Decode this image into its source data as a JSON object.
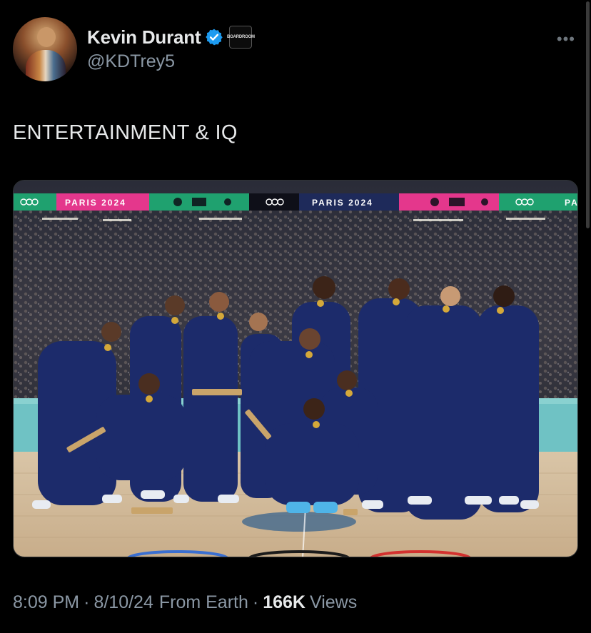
{
  "author": {
    "display_name": "Kevin Durant",
    "handle": "@KDTrey5",
    "verified": true,
    "affiliate_badge": "BOARDROOM"
  },
  "more_icon": "more-horizontal-icon",
  "tweet": {
    "text": "ENTERTAINMENT & IQ"
  },
  "media": {
    "banner_text": "PARIS 2024",
    "banner_text_partial": "PA"
  },
  "meta": {
    "time": "8:09 PM",
    "date": "8/10/24",
    "source": "From Earth",
    "views_count": "166K",
    "views_label": "Views"
  },
  "colors": {
    "background": "#000000",
    "text": "#e7e9ea",
    "secondary": "#8b98a5",
    "verified_blue": "#1d9bf0",
    "jersey_navy": "#1c2b6b",
    "banner_green": "#1fa16f",
    "banner_pink": "#e4378c"
  }
}
